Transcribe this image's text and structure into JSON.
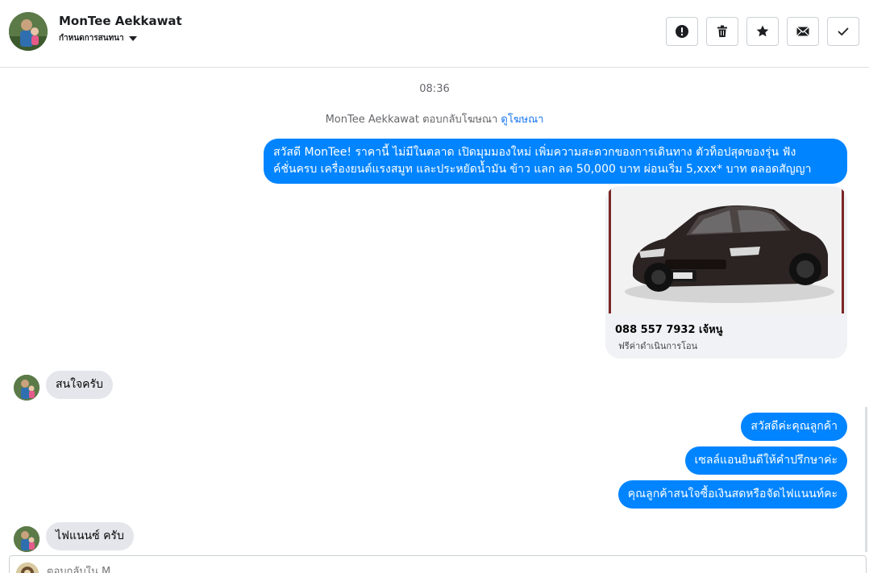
{
  "header": {
    "name": "MonTee Aekkawat",
    "status": "กำหนดการสนทนา",
    "actions": [
      {
        "icon": "alert-icon",
        "name": "report-button"
      },
      {
        "icon": "trash-icon",
        "name": "delete-button"
      },
      {
        "icon": "star-icon",
        "name": "star-button"
      },
      {
        "icon": "envelope-icon",
        "name": "mark-unread-button"
      },
      {
        "icon": "check-icon",
        "name": "mark-done-button"
      }
    ]
  },
  "conversation": {
    "timestamp": "08:36",
    "ad_reply_prefix": "MonTee Aekkawat ตอบกลับโฆษณา",
    "ad_reply_link": "ดูโฆษณา",
    "greeting_line1": "สวัสดี MonTee! ราคานี้ ไม่มีในตลาด เปิดมุมมองใหม่ เพิ่มความสะดวกของการเดินทาง ตัวท็อปสุดของรุ่น ฟัง",
    "greeting_line2": "ค์ชั่นครบ เครื่องยนต์แรงสมูท และประหยัดน้ำมัน ข้าว แลก ลด 50,000 บาท ผ่อนเริ่ม 5,xxx* บาท ตลอดสัญญา",
    "ad_card": {
      "title": "088 557 7932 เจ้หนู",
      "subtitle": "ฟรีค่าดำเนินการโอน"
    },
    "messages": [
      {
        "dir": "in",
        "text": "สนใจครับ"
      },
      {
        "dir": "out",
        "text": "สวัสดีค่ะคุณลูกค้า"
      },
      {
        "dir": "out",
        "text": "เซลล์แอนยินดีให้คำปรึกษาค่ะ"
      },
      {
        "dir": "out",
        "text": "คุณลูกค้าสนใจซื้อเงินสดหรือจัดไฟแนนท์คะ"
      },
      {
        "dir": "in",
        "text": "ไฟแนนซ์ ครับ"
      }
    ]
  },
  "composer": {
    "placeholder": "ตอบกลับใน M..."
  },
  "colors": {
    "outgoing": "#0084ff",
    "incoming": "#e4e6eb",
    "link": "#1876f2"
  }
}
